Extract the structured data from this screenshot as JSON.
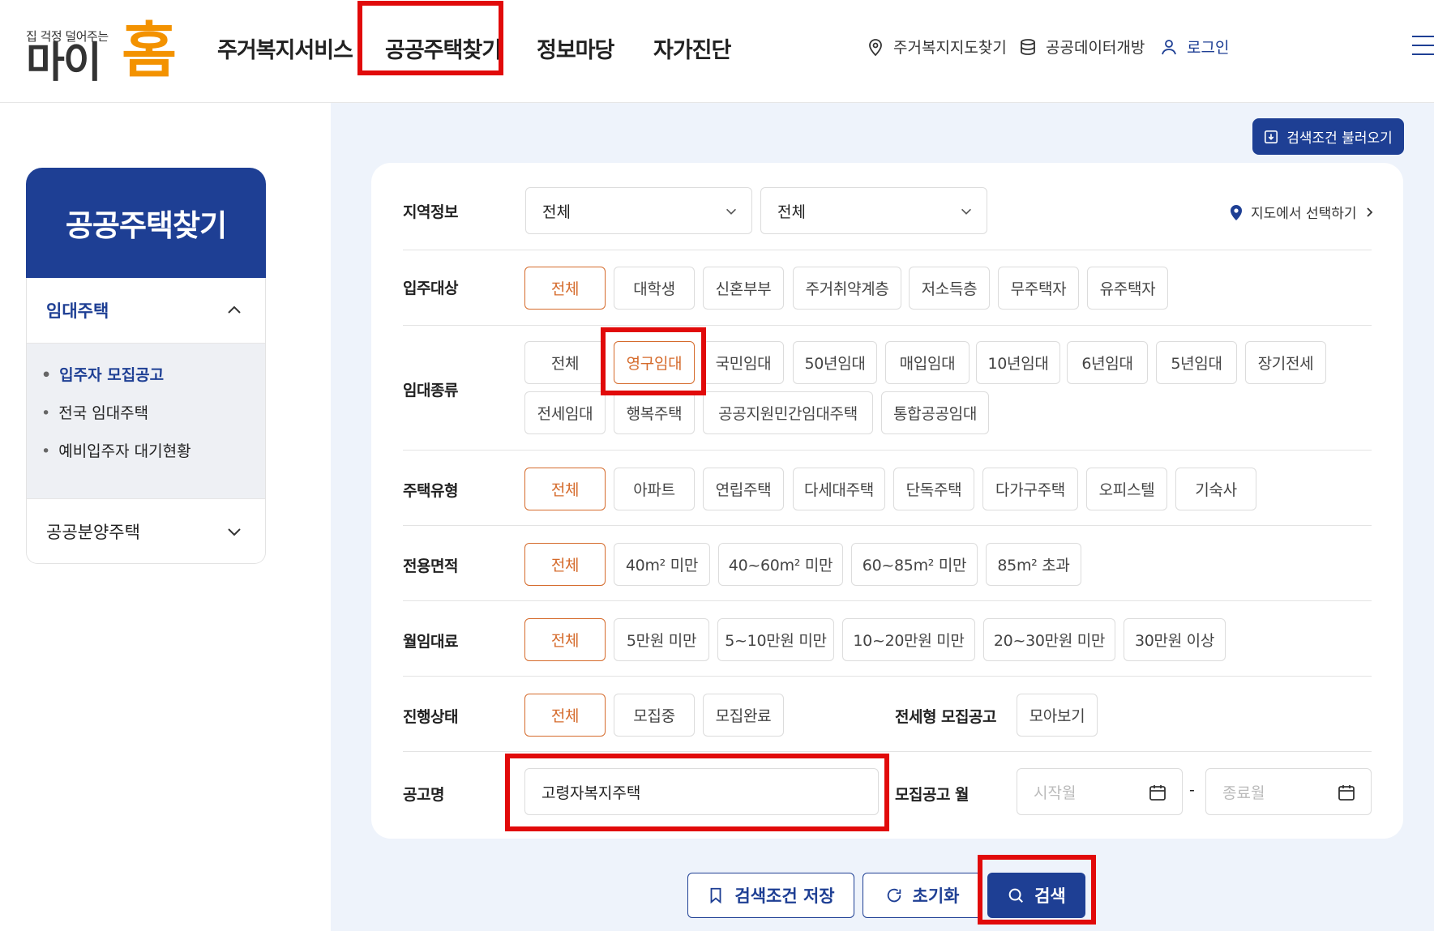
{
  "logo": {
    "tagline": "집 걱정 덜어주는",
    "main": "마이",
    "home": "홈"
  },
  "gnb": [
    "주거복지서비스",
    "공공주택찾기",
    "정보마당",
    "자가진단"
  ],
  "utils": {
    "map_finder": "주거복지지도찾기",
    "open_data": "공공데이터개방",
    "login": "로그인"
  },
  "sidebar": {
    "title": "공공주택찾기",
    "rental_section": "임대주택",
    "rental_items": [
      "입주자 모집공고",
      "전국 임대주택",
      "예비입주자 대기현황"
    ],
    "sale_section": "공공분양주택"
  },
  "search": {
    "load_conditions": "검색조건 불러오기",
    "region": {
      "label": "지역정보",
      "select1": "전체",
      "select2": "전체",
      "map_link": "지도에서 선택하기"
    },
    "target": {
      "label": "입주대상",
      "options": [
        "전체",
        "대학생",
        "신혼부부",
        "주거취약계층",
        "저소득층",
        "무주택자",
        "유주택자"
      ]
    },
    "rental_type": {
      "label": "임대종류",
      "row1": [
        "전체",
        "영구임대",
        "국민임대",
        "50년임대",
        "매입임대",
        "10년임대",
        "6년임대",
        "5년임대",
        "장기전세"
      ],
      "row2": [
        "전세임대",
        "행복주택",
        "공공지원민간임대주택",
        "통합공공임대"
      ]
    },
    "house_type": {
      "label": "주택유형",
      "options": [
        "전체",
        "아파트",
        "연립주택",
        "다세대주택",
        "단독주택",
        "다가구주택",
        "오피스텔",
        "기숙사"
      ]
    },
    "area": {
      "label": "전용면적",
      "options": [
        "전체",
        "40m² 미만",
        "40~60m² 미만",
        "60~85m² 미만",
        "85m² 초과"
      ]
    },
    "rent": {
      "label": "월임대료",
      "options": [
        "전체",
        "5만원 미만",
        "5~10만원 미만",
        "10~20만원 미만",
        "20~30만원 미만",
        "30만원 이상"
      ]
    },
    "status": {
      "label": "진행상태",
      "options": [
        "전체",
        "모집중",
        "모집완료"
      ],
      "jeonse_label": "전세형 모집공고",
      "jeonse_btn": "모아보기"
    },
    "notice": {
      "label": "공고명",
      "value": "고령자복지주택",
      "month_label": "모집공고 월",
      "start_placeholder": "시작월",
      "end_placeholder": "종료월",
      "dash": "-"
    },
    "buttons": {
      "save": "검색조건 저장",
      "reset": "초기화",
      "search": "검색"
    }
  },
  "colors": {
    "primary": "#1e3f94",
    "accent": "#d56b2c",
    "logo_orange": "#f39200",
    "highlight": "#e10a0a"
  }
}
